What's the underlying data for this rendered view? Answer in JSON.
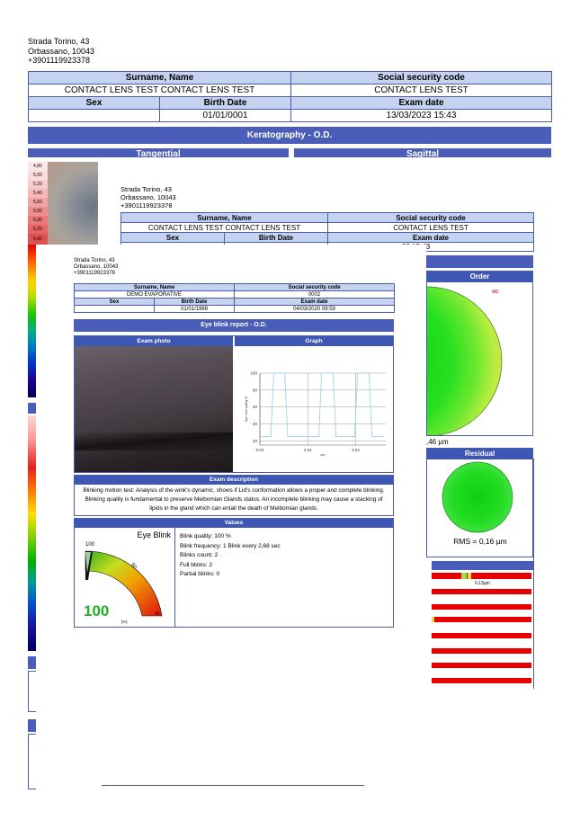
{
  "bg_report": {
    "address": [
      "Strada Torino, 43",
      "Orbassano, 10043",
      "+3901119923378"
    ],
    "headers": {
      "name": "Surname, Name",
      "ssc": "Social security code",
      "sex": "Sex",
      "birth": "Birth Date",
      "exam": "Exam date"
    },
    "name": "CONTACT LENS TEST CONTACT LENS TEST",
    "ssc": "CONTACT LENS TEST",
    "sex": "",
    "birth": "01/01/0001",
    "exam": "13/03/2023 15:43",
    "section": "Keratography - O.D.",
    "tangential": "Tangential",
    "sagittal": "Sagittal",
    "scale": [
      "4,80",
      "5,00",
      "5,20",
      "5,40",
      "5,60",
      "5,80",
      "6,00",
      "6,20",
      "6,42"
    ]
  },
  "mid_report": {
    "address": [
      "Strada Torino, 43",
      "Orbassano, 10043",
      "+3901119923378"
    ],
    "headers": {
      "name": "Surname, Name",
      "ssc": "Social security code",
      "sex": "Sex",
      "birth": "Birth Date",
      "exam": "Exam date"
    },
    "name": "CONTACT LENS TEST CONTACT LENS TEST",
    "ssc": "CONTACT LENS TEST",
    "exam_partial": "23 15:43",
    "order": "Order",
    "inf": "∞",
    "rms1": ",46 µm",
    "residual": "Residual",
    "rms2": "RMS = 0,16 µm",
    "bar_label": "0.13µm"
  },
  "front_report": {
    "address": [
      "Strada Torino, 43",
      "Orbassano, 10043",
      "+3901119923378"
    ],
    "headers": {
      "name": "Surname, Name",
      "ssc": "Social security code",
      "sex": "Sex",
      "birth": "Birth Date",
      "exam": "Exam date"
    },
    "name": "DEMO EVAPORATIVE",
    "ssc": "0002",
    "sex": "",
    "birth": "01/01/1969",
    "exam": "04/03/2020 09:59",
    "title": "Eye blink report - O.D.",
    "exam_photo": "Exam photo",
    "graph": "Graph",
    "desc_title": "Exam description",
    "description": "Blinking motion test: Analysis of the wink's dynamic, shows if Lid's conformation allows a proper and complete blinking. Blinking quality is fundamental to preserve Meibomian Glands status. An incomplete blinking may cause a stacking of lipids in the gland which can entail the death of Meibomian glands.",
    "values_title": "Values",
    "gauge": {
      "title": "Eye Blink",
      "top": "100",
      "mid": "50",
      "zero": "0",
      "value": 100,
      "unit": "[%]"
    },
    "values": [
      "Blink quality: 100 %",
      "Blink frequency: 1 Blink every 2,68 sec",
      "Blinks count: 2",
      "Full blinks: 2",
      "Partial blinks: 0"
    ],
    "chart_data": {
      "type": "line",
      "ylabel": "Eye cover quality %",
      "xlabel": "sec",
      "xticks": [
        "0.04",
        "2.04",
        "4.04"
      ],
      "yticks": [
        "100",
        "80",
        "60",
        "40",
        "20"
      ],
      "ylim": [
        15,
        100
      ],
      "xlim": [
        0.04,
        5.3
      ],
      "series": [
        {
          "x": [
            0.04,
            0.5,
            0.62,
            0.72,
            0.85,
            1.08,
            1.2,
            1.32,
            1.44,
            1.56,
            1.68,
            2.5,
            2.62,
            2.72,
            2.85,
            3.1,
            3.22,
            3.34,
            3.46,
            3.58,
            3.7,
            4.0,
            4.12,
            4.22,
            4.35,
            4.6,
            4.72,
            4.84,
            4.96,
            5.08,
            5.2
          ],
          "y": [
            25,
            25,
            100,
            100,
            100,
            100,
            25,
            25,
            25,
            25,
            25,
            25,
            100,
            100,
            100,
            100,
            25,
            25,
            25,
            25,
            25,
            25,
            100,
            100,
            100,
            100,
            25,
            25,
            25,
            25,
            25
          ]
        }
      ]
    }
  },
  "colors": {
    "band": "#4a5db8",
    "header_cell": "#c5d3f0",
    "border": "#4a5da8",
    "line": "#9fd3e8"
  }
}
